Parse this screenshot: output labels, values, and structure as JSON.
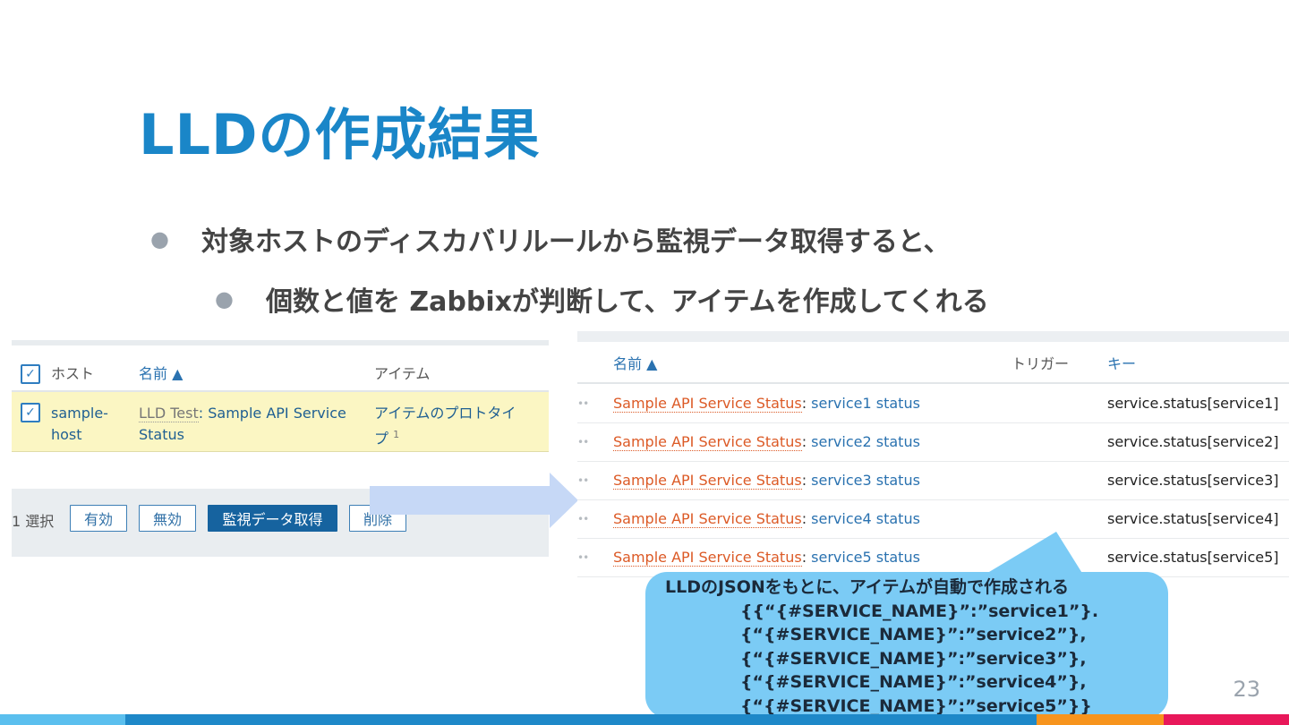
{
  "slide": {
    "title": "LLDの作成結果",
    "bullet1": "対象ホストのディスカバリルールから監視データ取得すると、",
    "bullet2": "個数と値を Zabbixが判断して、アイテムを作成してくれる",
    "page_number": "23"
  },
  "left_panel": {
    "header": {
      "host": "ホスト",
      "name": "名前 ▲",
      "items": "アイテム"
    },
    "row": {
      "host": "sample-host",
      "name_prefix": "LLD Test",
      "name_sep": ": ",
      "name": "Sample API Service Status",
      "items_link": "アイテムのプロトタイプ",
      "items_count": "1"
    },
    "footer": {
      "selected": "1 選択",
      "enable_label": "有効",
      "disable_label": "無効",
      "get_data_label": "監視データ取得",
      "delete_label": "削除"
    }
  },
  "right_panel": {
    "header": {
      "name": "名前 ▲",
      "triggers": "トリガー",
      "key": "キー"
    },
    "rows": [
      {
        "prefix": "Sample API Service Status",
        "name": "service1 status",
        "key": "service.status[service1]"
      },
      {
        "prefix": "Sample API Service Status",
        "name": "service2 status",
        "key": "service.status[service2]"
      },
      {
        "prefix": "Sample API Service Status",
        "name": "service3 status",
        "key": "service.status[service3]"
      },
      {
        "prefix": "Sample API Service Status",
        "name": "service4 status",
        "key": "service.status[service4]"
      },
      {
        "prefix": "Sample API Service Status",
        "name": "service5 status",
        "key": "service.status[service5]"
      }
    ]
  },
  "callout": {
    "lead": "LLDのJSONをもとに、アイテムが自動で作成される",
    "lines": [
      "{{“{#SERVICE_NAME}”:”service1”}.",
      "{“{#SERVICE_NAME}”:”service2”},",
      "{“{#SERVICE_NAME}”:”service3”},",
      "{“{#SERVICE_NAME}”:”service4”},",
      "{“{#SERVICE_NAME}”:”service5”}}"
    ]
  },
  "colors": {
    "title": "#1a86c8",
    "bottom_bar": [
      "#5bbfee",
      "#1e88c8",
      "#f7941d",
      "#e8185a"
    ]
  }
}
